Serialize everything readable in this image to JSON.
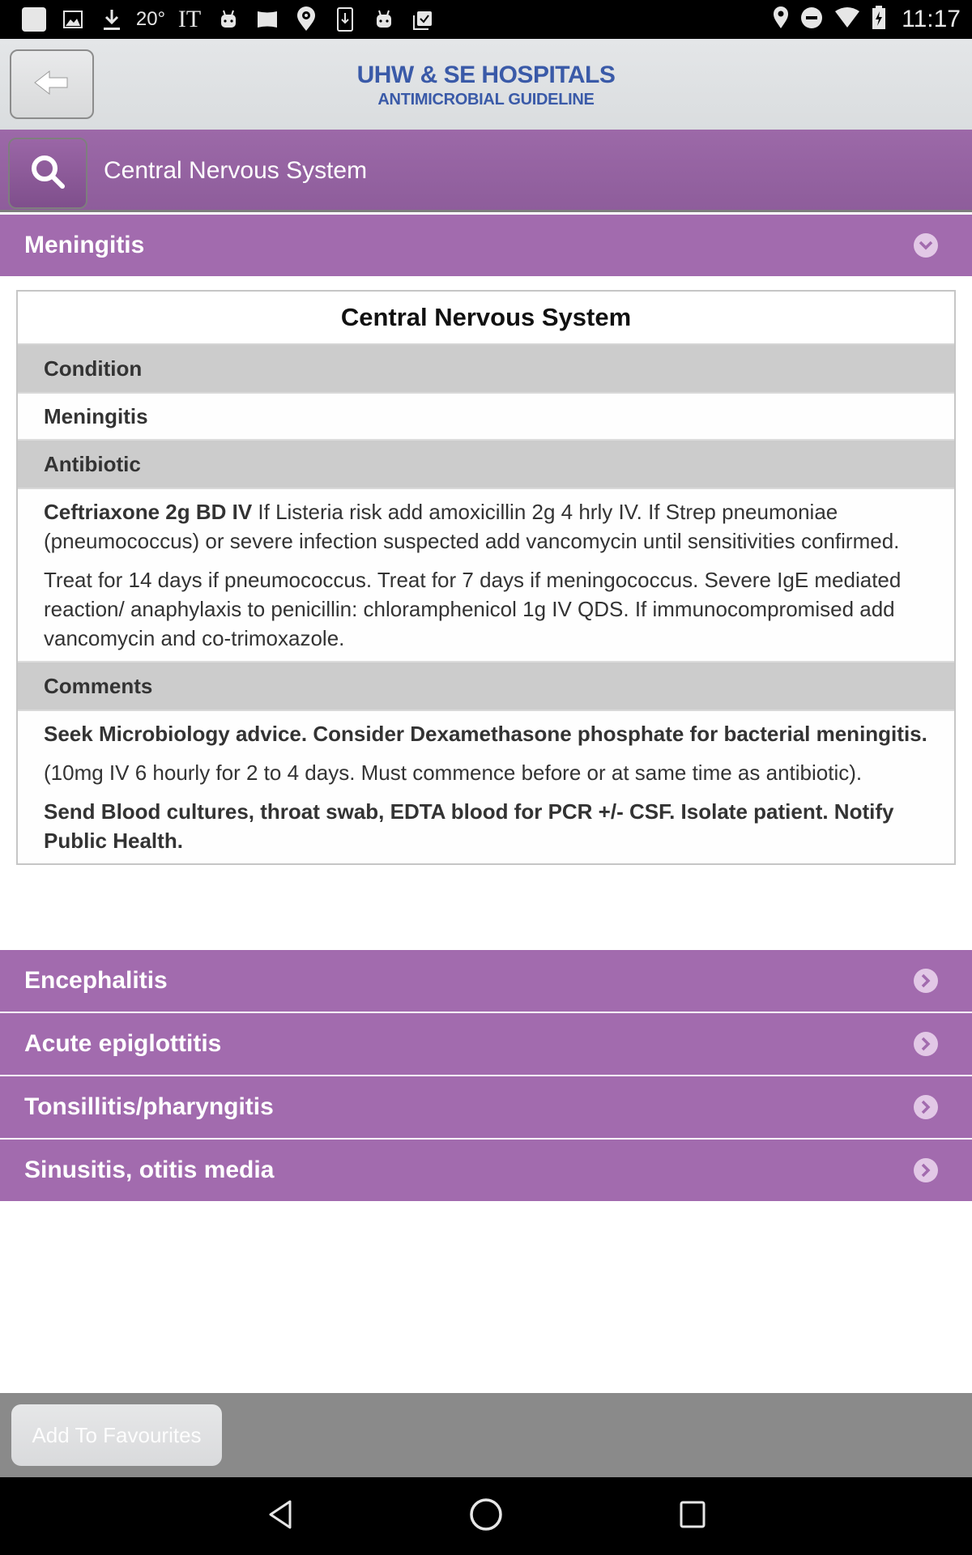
{
  "status_bar": {
    "left_icons": [
      "blank-notification-icon",
      "image-icon",
      "download-icon",
      "temperature-20-icon",
      "it-text-icon",
      "android-icon",
      "flag-icon",
      "location-target-icon",
      "phone-download-icon",
      "android-icon",
      "clipboard-check-icon"
    ],
    "temperature": "20°",
    "it_label": "IT",
    "right_icons": [
      "location-icon",
      "do-not-disturb-icon",
      "wifi-icon",
      "battery-charging-icon"
    ],
    "time": "11:17"
  },
  "header": {
    "back_label": "Back",
    "logo_line1": "UHW & SE HOSPITALS",
    "logo_line2": "ANTIMICROBIAL GUIDELINE"
  },
  "search": {
    "value": "Central Nervous System",
    "placeholder": "Search"
  },
  "sections": [
    {
      "label": "Meningitis",
      "expanded": true
    },
    {
      "label": "Encephalitis",
      "expanded": false
    },
    {
      "label": "Acute epiglottitis",
      "expanded": false
    },
    {
      "label": "Tonsillitis/pharyngitis",
      "expanded": false
    },
    {
      "label": "Sinusitis, otitis media",
      "expanded": false
    }
  ],
  "detail": {
    "title": "Central Nervous System",
    "condition_label": "Condition",
    "condition_value": "Meningitis",
    "antibiotic_label": "Antibiotic",
    "antibiotic_p1_bold": "Ceftriaxone 2g BD IV",
    "antibiotic_p1_rest": " If Listeria risk add amoxicillin 2g 4 hrly IV. If Strep pneumoniae (pneumococcus) or severe infection suspected add vancomycin until sensitivities confirmed.",
    "antibiotic_p2": "Treat for 14 days if pneumococcus. Treat for 7 days if meningococcus. Severe IgE mediated reaction/ anaphylaxis to penicillin: chloramphenicol 1g IV QDS. If immunocompromised add vancomycin and co-trimoxazole.",
    "comments_label": "Comments",
    "comments_p1": "Seek Microbiology advice. Consider Dexamethasone phosphate for bacterial meningitis.",
    "comments_p2": "(10mg IV 6 hourly for 2 to 4 days. Must commence before or at same time as antibiotic).",
    "comments_p3": "Send Blood cultures, throat swab, EDTA blood for PCR +/- CSF. Isolate patient. Notify Public Health."
  },
  "footer": {
    "favourites_label": "Add To Favourites"
  },
  "colors": {
    "accent_purple": "#a26bae",
    "logo_blue": "#3a5aa8",
    "label_gray": "#cccccc",
    "footer_gray": "#8a8a8a"
  }
}
